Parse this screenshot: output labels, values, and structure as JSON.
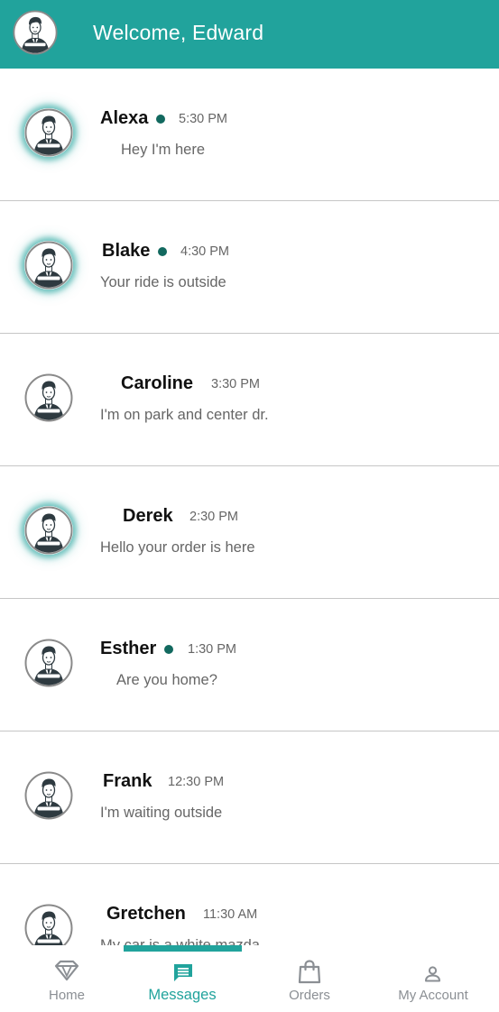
{
  "header": {
    "welcome_text": "Welcome, Edward"
  },
  "conversations": [
    {
      "name": "Alexa",
      "online": true,
      "time": "5:30 PM",
      "message": "Hey I'm here",
      "highlighted": true
    },
    {
      "name": "Blake",
      "online": true,
      "time": "4:30 PM",
      "message": "Your ride is outside",
      "highlighted": true
    },
    {
      "name": "Caroline",
      "online": false,
      "time": "3:30 PM",
      "message": "I'm on park and center dr.",
      "highlighted": false
    },
    {
      "name": "Derek",
      "online": false,
      "time": "2:30 PM",
      "message": "Hello your order is here",
      "highlighted": true
    },
    {
      "name": "Esther",
      "online": true,
      "time": "1:30 PM",
      "message": "Are you home?",
      "highlighted": false
    },
    {
      "name": "Frank",
      "online": false,
      "time": "12:30 PM",
      "message": "I'm waiting outside",
      "highlighted": false
    },
    {
      "name": "Gretchen",
      "online": false,
      "time": "11:30 AM",
      "message": "My car is a white mazda",
      "highlighted": false
    }
  ],
  "bottom_nav": {
    "items": [
      {
        "label": "Home",
        "icon": "home-diamond-icon",
        "active": false
      },
      {
        "label": "Messages",
        "icon": "messages-icon",
        "active": true
      },
      {
        "label": "Orders",
        "icon": "shopping-bag-icon",
        "active": false
      },
      {
        "label": "My Account",
        "icon": "account-icon",
        "active": false
      }
    ]
  },
  "colors": {
    "accent": "#21a39c",
    "online_dot": "#12695f",
    "divider": "#c6c6c6",
    "muted_text": "#666666",
    "nav_inactive": "#8b8f94"
  }
}
